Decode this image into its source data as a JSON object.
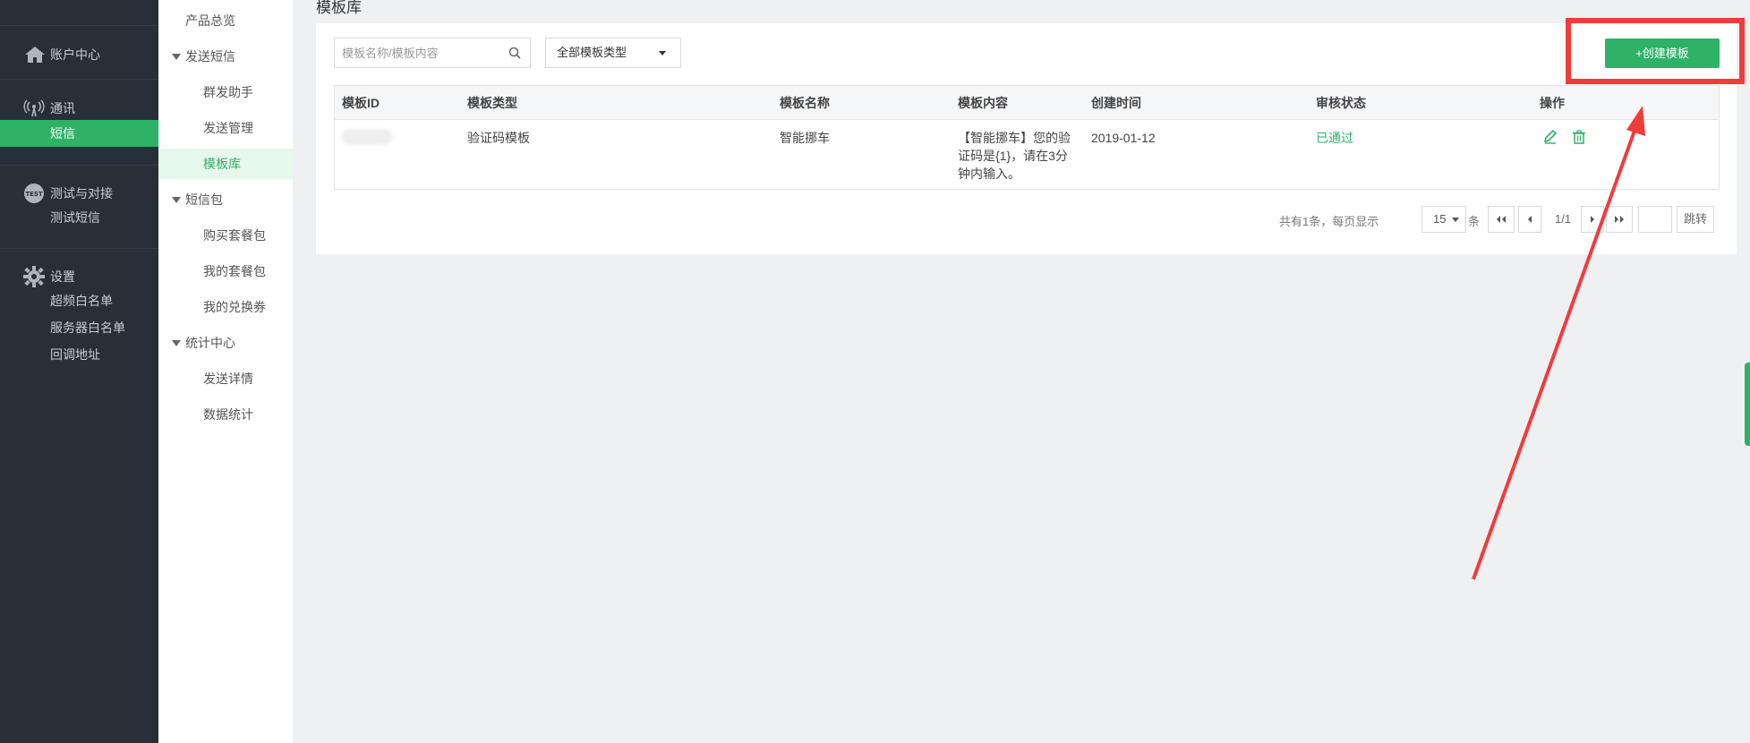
{
  "sidebar": {
    "account": {
      "label": "账户中心",
      "icon": "home-icon"
    },
    "comm": {
      "label": "通讯",
      "icon": "signal-icon",
      "items": [
        "短信"
      ]
    },
    "test": {
      "label": "测试与对接",
      "icon": "test-icon",
      "badge": "TEST",
      "items": [
        "测试短信"
      ]
    },
    "settings": {
      "label": "设置",
      "icon": "gear-icon",
      "items": [
        "超频白名单",
        "服务器白名单",
        "回调地址"
      ]
    }
  },
  "subnav": {
    "overview": "产品总览",
    "send_sms": "发送短信",
    "group_helper": "群发助手",
    "send_mgmt": "发送管理",
    "template_lib": "模板库",
    "sms_pack": "短信包",
    "buy_pack": "购买套餐包",
    "my_pack": "我的套餐包",
    "my_coupon": "我的兑换券",
    "stats_center": "统计中心",
    "send_detail": "发送详情",
    "data_stats": "数据统计"
  },
  "main": {
    "title": "模板库",
    "search_placeholder": "模板名称/模板内容",
    "type_filter": "全部模板类型",
    "create_button": "+创建模板"
  },
  "table": {
    "headers": [
      "模板ID",
      "模板类型",
      "模板名称",
      "模板内容",
      "创建时间",
      "审核状态",
      "操作"
    ],
    "rows": [
      {
        "type": "验证码模板",
        "name": "智能挪车",
        "content": "【智能挪车】您的验证码是{1}，请在3分钟内输入。",
        "created": "2019-01-12",
        "status": "已通过"
      }
    ]
  },
  "pagination": {
    "summary": "共有1条，每页显示",
    "page_size": "15",
    "unit": "条",
    "current": "1/1",
    "go": "跳转"
  },
  "colors": {
    "accent": "#2eb267",
    "sidebar_bg": "#273038",
    "annotation": "#f13b3b"
  }
}
